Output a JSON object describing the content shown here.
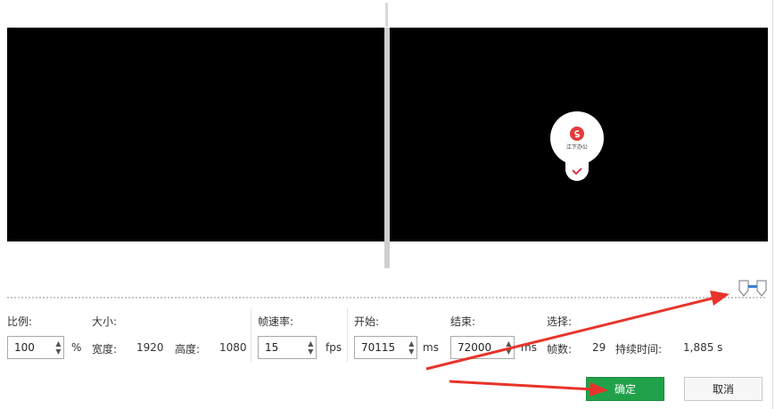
{
  "labels": {
    "ratio": "比例:",
    "size": "大小:",
    "framerate": "帧速率:",
    "start": "开始:",
    "end": "结束:",
    "selection": "选择:",
    "width": "宽度:",
    "height": "高度:",
    "frames": "帧数:",
    "duration": "持续时间:"
  },
  "values": {
    "ratio": "100",
    "ratio_unit": "%",
    "width": "1920",
    "height": "1080",
    "framerate": "15",
    "framerate_unit": "fps",
    "start": "70115",
    "start_unit": "ms",
    "end": "72000",
    "end_unit": "ms",
    "frames": "29",
    "duration": "1,885 s"
  },
  "watermark": {
    "text": "江下办公"
  },
  "buttons": {
    "ok": "确定",
    "cancel": "取消"
  },
  "colors": {
    "ok_green": "#21a24a",
    "annotation_red": "#e8332a"
  },
  "icons": {
    "range_handles": "trim-range-handles-icon",
    "spin": "spinner-arrows-icon",
    "check": "check-icon"
  }
}
